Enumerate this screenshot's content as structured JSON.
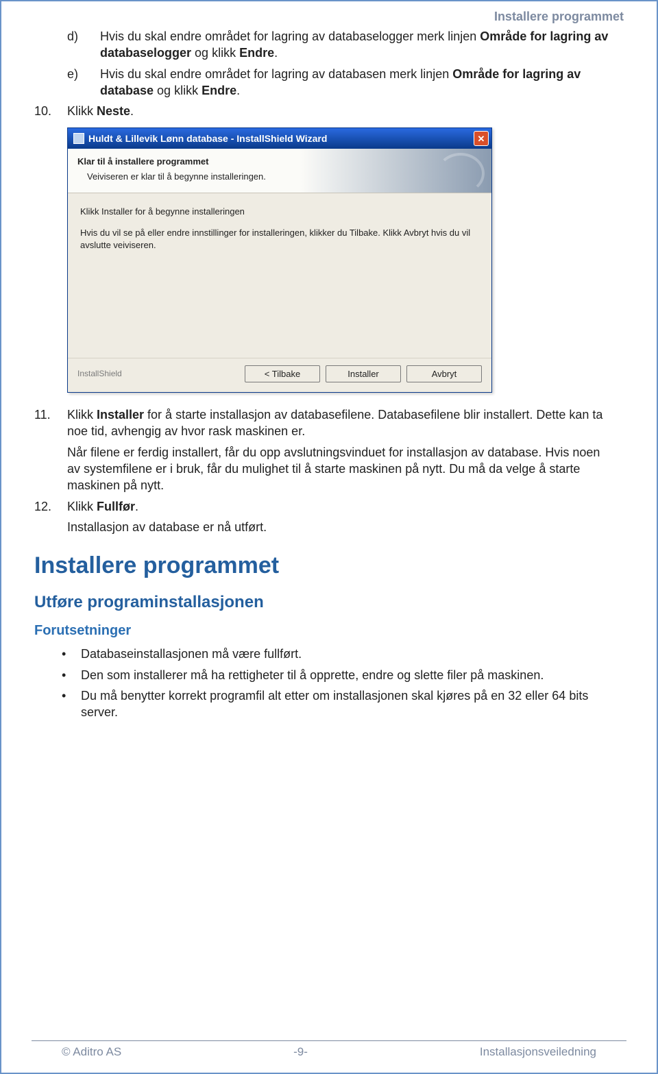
{
  "header_right": "Installere programmet",
  "body": {
    "item_d_marker": "d)",
    "item_d_text_before": "Hvis du skal endre området for lagring av databaselogger merk linjen ",
    "item_d_bold1": "Område for lagring av databaselogger",
    "item_d_mid": " og klikk ",
    "item_d_bold2": "Endre",
    "item_d_end": ".",
    "item_e_marker": "e)",
    "item_e_text_before": "Hvis du skal endre området for lagring av databasen merk linjen ",
    "item_e_bold1": "Område for lagring av database",
    "item_e_mid": " og klikk ",
    "item_e_bold2": "Endre",
    "item_e_end": ".",
    "item_10_marker": "10.",
    "item_10_pre": "Klikk ",
    "item_10_bold": "Neste",
    "item_10_end": "."
  },
  "wizard": {
    "title": "Huldt & Lillevik Lønn database - InstallShield Wizard",
    "banner_title": "Klar til å installere programmet",
    "banner_sub": "Veiviseren er klar til å begynne installeringen.",
    "body_line1": "Klikk Installer for å begynne installeringen",
    "body_line2": "Hvis du vil se på eller endre innstillinger for installeringen, klikker du Tilbake. Klikk Avbryt hvis du vil avslutte veiviseren.",
    "brand": "InstallShield",
    "btn_back": "< Tilbake",
    "btn_install": "Installer",
    "btn_cancel": "Avbryt"
  },
  "after": {
    "item_11_marker": "11.",
    "item_11_pre": "Klikk ",
    "item_11_bold": "Installer",
    "item_11_post": " for å starte installasjon av databasefilene. Databasefilene blir installert. Dette kan ta noe tid, avhengig av hvor rask maskinen er.",
    "item_11_para2": "Når filene er ferdig installert, får du opp avslutningsvinduet for installasjon av database. Hvis noen av systemfilene er i bruk, får du mulighet til å starte maskinen på nytt. Du må da velge å starte maskinen på nytt.",
    "item_12_marker": "12.",
    "item_12_pre": "Klikk ",
    "item_12_bold": "Fullfør",
    "item_12_end": ".",
    "item_12_para2": "Installasjon av database er nå utført."
  },
  "sections": {
    "h1": "Installere programmet",
    "h2": "Utføre programinstallasjonen",
    "h3": "Forutsetninger",
    "bullets": [
      "Databaseinstallasjonen må være fullført.",
      "Den som installerer må ha rettigheter til å opprette, endre og slette filer på maskinen.",
      "Du må benytter korrekt programfil alt etter om installasjonen skal kjøres på en 32 eller 64 bits server."
    ]
  },
  "footer": {
    "left": "© Aditro AS",
    "center": "-9-",
    "right": "Installasjonsveiledning"
  }
}
